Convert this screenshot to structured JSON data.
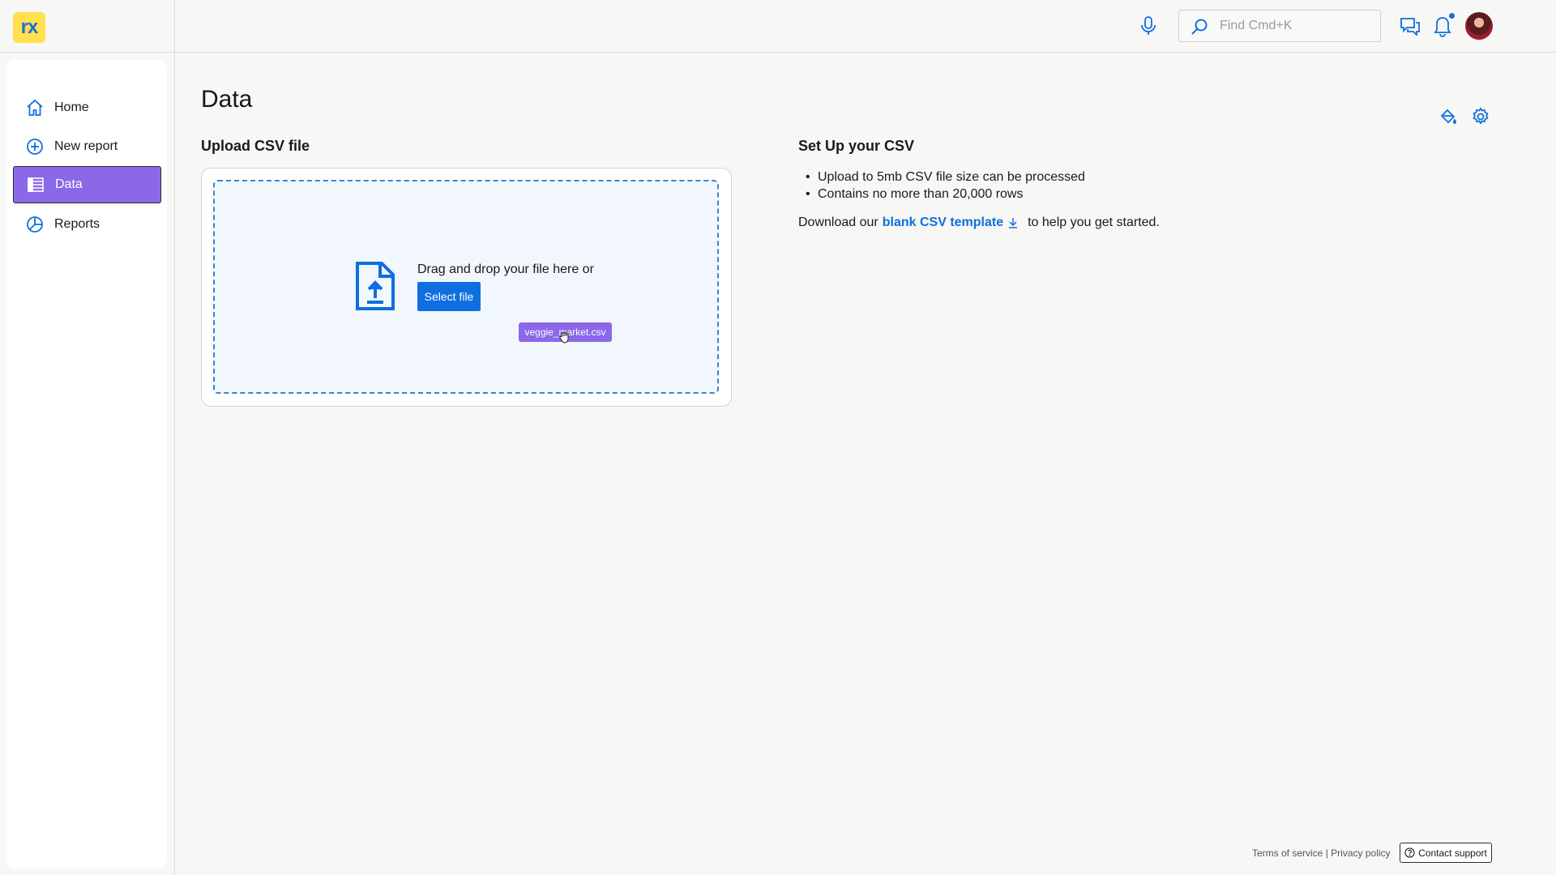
{
  "app": {
    "logo_text": "rx"
  },
  "header": {
    "search_placeholder": "Find Cmd+K",
    "icons": [
      "microphone-icon",
      "search-icon",
      "chat-icon",
      "bell-icon",
      "avatar"
    ]
  },
  "sidebar": {
    "items": [
      {
        "label": "Home",
        "icon": "home-icon",
        "active": false
      },
      {
        "label": "New report",
        "icon": "plus-circle-icon",
        "active": false
      },
      {
        "label": "Data",
        "icon": "table-icon",
        "active": true
      },
      {
        "label": "Reports",
        "icon": "pie-chart-icon",
        "active": false
      }
    ]
  },
  "main": {
    "title": "Data",
    "upload": {
      "heading": "Upload CSV file",
      "drop_text": "Drag and drop your file here or",
      "select_button": "Select file",
      "dragging_file": "veggie_market.csv"
    },
    "setup": {
      "heading": "Set Up your CSV",
      "requirements": [
        "Upload to 5mb CSV file size can be processed",
        "Contains no more than 20,000 rows"
      ],
      "download_prefix": "Download our",
      "template_link": "blank CSV template",
      "download_suffix": "to help you get started."
    }
  },
  "footer": {
    "terms": "Terms of service",
    "separator": "|",
    "privacy": "Privacy policy",
    "support": "Contact support"
  },
  "colors": {
    "accent": "#8b68e8",
    "primary": "#0f6fe0",
    "logo_bg": "#ffe14d",
    "background": "#f7f7f5"
  }
}
